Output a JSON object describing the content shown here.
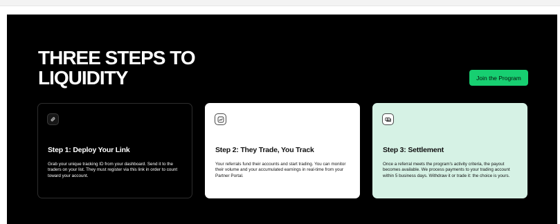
{
  "colors": {
    "hero_background": "#000000",
    "accent": "#17cf71",
    "card_dark": "#000000",
    "card_light": "#ffffff",
    "card_mint": "#d6f2e5"
  },
  "hero": {
    "headline": "THREE STEPS TO LIQUIDITY",
    "cta_label": "Join the Program"
  },
  "steps": [
    {
      "icon": "link-icon",
      "title": "Step 1: Deploy Your Link",
      "body": "Grab your unique tracking ID from your dashboard. Send it to the traders on your list. They must register via this link in order to count toward your account."
    },
    {
      "icon": "chart-icon",
      "title": "Step 2: They Trade, You Track",
      "body": "Your referrals fund their accounts and start trading. You can monitor their volume and your accumulated earnings in real-time from your Partner Portal."
    },
    {
      "icon": "cash-icon",
      "title": "Step 3: Settlement",
      "body": "Once a referral meets the program's activity criteria, the payout becomes available. We process payments to your trading account within 5 business days. Withdraw it or trade it: the choice is yours."
    }
  ]
}
